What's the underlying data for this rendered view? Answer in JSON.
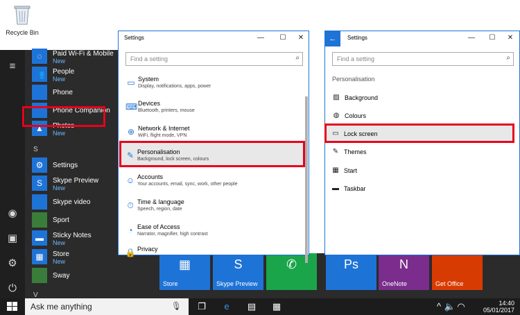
{
  "desktop": {
    "recycle_label": "Recycle Bin"
  },
  "start_menu": {
    "apps": [
      {
        "name": "Paid Wi-Fi & Mobile",
        "badge": "New",
        "icon": "wifi-icon"
      },
      {
        "name": "People",
        "badge": "New",
        "icon": "people-icon"
      },
      {
        "name": "Phone",
        "badge": "",
        "icon": "phone-icon"
      },
      {
        "name": "Phone Companion",
        "badge": "",
        "icon": "phone-companion-icon"
      },
      {
        "name": "Photos",
        "badge": "New",
        "icon": "photos-icon"
      },
      {
        "name": "Settings",
        "badge": "",
        "icon": "gear-icon"
      },
      {
        "name": "Skype Preview",
        "badge": "New",
        "icon": "skype-icon"
      },
      {
        "name": "Skype video",
        "badge": "",
        "icon": "skype-video-icon"
      },
      {
        "name": "Sport",
        "badge": "",
        "icon": "sport-icon"
      },
      {
        "name": "Sticky Notes",
        "badge": "New",
        "icon": "sticky-notes-icon"
      },
      {
        "name": "Store",
        "badge": "New",
        "icon": "store-icon"
      },
      {
        "name": "Sway",
        "badge": "",
        "icon": "sway-icon"
      }
    ],
    "section_letters": [
      "S",
      "V"
    ]
  },
  "tiles": [
    {
      "label": "Store",
      "color": "#1e73d6"
    },
    {
      "label": "Skype Preview",
      "color": "#1e73d6"
    },
    {
      "label": "",
      "color": "#1aa54a"
    },
    {
      "label": "",
      "color": "#2b2b2b"
    },
    {
      "label": "",
      "color": "#1e73d6"
    },
    {
      "label": "OneNote",
      "color": "#7a2d8c"
    },
    {
      "label": "Get Office",
      "color": "#d83b01"
    }
  ],
  "taskbar": {
    "search_placeholder": "Ask me anything",
    "time": "14:40",
    "date": "05/01/2017"
  },
  "settings_window": {
    "title": "Settings",
    "search_placeholder": "Find a setting",
    "categories": [
      {
        "title": "System",
        "subtitle": "Display, notifications, apps, power",
        "icon": "laptop-icon"
      },
      {
        "title": "Devices",
        "subtitle": "Bluetooth, printers, mouse",
        "icon": "devices-icon"
      },
      {
        "title": "Network & Internet",
        "subtitle": "WiFi, flight mode, VPN",
        "icon": "globe-icon"
      },
      {
        "title": "Personalisation",
        "subtitle": "Background, lock screen, colours",
        "icon": "brush-icon"
      },
      {
        "title": "Accounts",
        "subtitle": "Your accounts, email, sync, work, other people",
        "icon": "person-icon"
      },
      {
        "title": "Time & language",
        "subtitle": "Speech, region, date",
        "icon": "clock-language-icon"
      },
      {
        "title": "Ease of Access",
        "subtitle": "Narrator, magnifier, high contrast",
        "icon": "ease-of-access-icon"
      },
      {
        "title": "Privacy",
        "subtitle": "",
        "icon": "lock-icon"
      }
    ]
  },
  "personalisation_window": {
    "title": "Settings",
    "search_placeholder": "Find a setting",
    "heading": "Personalisation",
    "items": [
      {
        "label": "Background",
        "icon": "image-icon"
      },
      {
        "label": "Colours",
        "icon": "palette-icon"
      },
      {
        "label": "Lock screen",
        "icon": "lock-screen-icon"
      },
      {
        "label": "Themes",
        "icon": "themes-icon"
      },
      {
        "label": "Start",
        "icon": "start-icon"
      },
      {
        "label": "Taskbar",
        "icon": "taskbar-icon"
      }
    ]
  },
  "highlight_color": "#e8001c",
  "accent_color": "#1e73d6"
}
